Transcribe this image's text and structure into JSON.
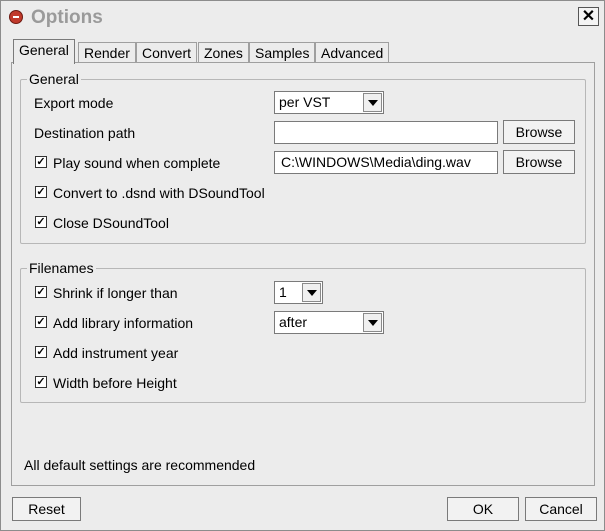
{
  "window": {
    "title": "Options",
    "close_label": "✕"
  },
  "tabs": [
    "General",
    "Render",
    "Convert",
    "Zones",
    "Samples",
    "Advanced"
  ],
  "general": {
    "legend": "General",
    "export_mode_label": "Export mode",
    "export_mode_value": "per VST",
    "destination_label": "Destination path",
    "destination_value": "",
    "browse_label": "Browse",
    "play_sound_label": "Play sound when complete",
    "play_sound_checked": true,
    "sound_path": "C:\\WINDOWS\\Media\\ding.wav",
    "convert_label": "Convert to .dsnd with DSoundTool",
    "convert_checked": true,
    "close_tool_label": "Close DSoundTool",
    "close_tool_checked": true
  },
  "filenames": {
    "legend": "Filenames",
    "shrink_label": "Shrink if longer than",
    "shrink_checked": true,
    "shrink_value": "1",
    "library_label": "Add library information",
    "library_checked": true,
    "library_value": "after",
    "year_label": "Add instrument year",
    "year_checked": true,
    "width_label": "Width before Height",
    "width_checked": true
  },
  "footer": {
    "note": "All default settings are recommended",
    "reset_label": "Reset",
    "ok_label": "OK",
    "cancel_label": "Cancel"
  },
  "check_glyph": "✓"
}
